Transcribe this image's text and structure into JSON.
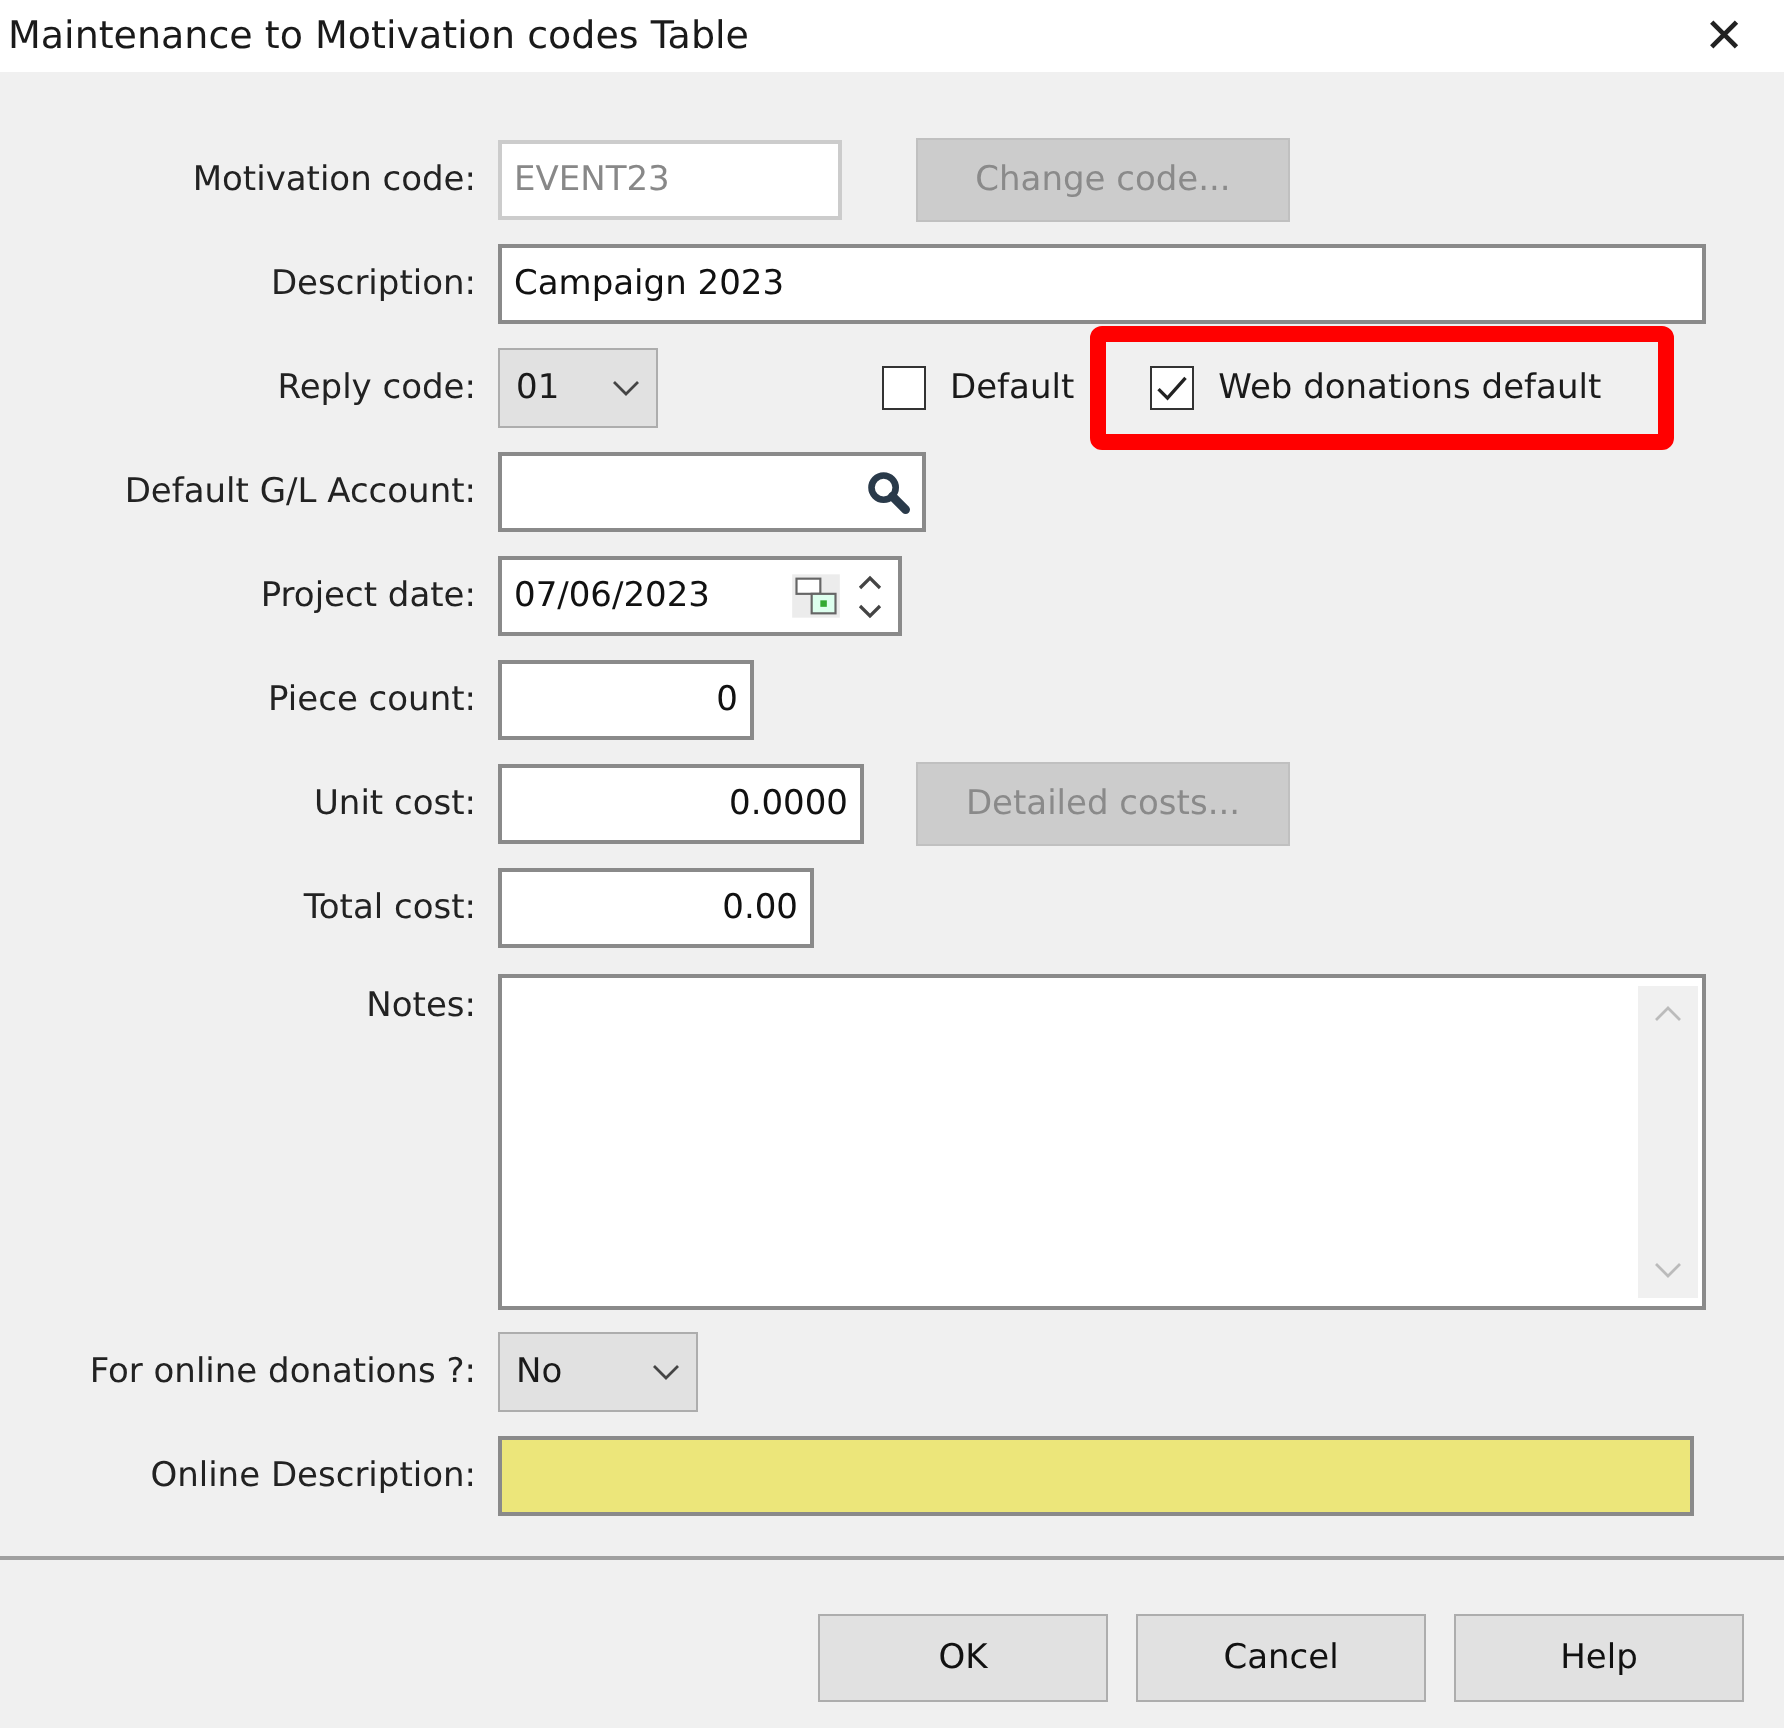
{
  "window": {
    "title": "Maintenance to Motivation codes Table",
    "close": "✕"
  },
  "motivation_code": {
    "label": "Motivation code:",
    "value": "EVENT23",
    "disabled": true,
    "button": "Change code...",
    "button_disabled": true
  },
  "description": {
    "label": "Description:",
    "value": "Campaign 2023"
  },
  "reply_code": {
    "label": "Reply code:",
    "value": "01"
  },
  "checkboxes": [
    {
      "label": "Default",
      "checked": false,
      "highlighted": false
    },
    {
      "label": "Web donations default",
      "checked": true,
      "highlighted": true
    }
  ],
  "gl_account": {
    "label": "Default G/L Account:"
  },
  "project_date": {
    "label": "Project date:",
    "value": "07/06/2023"
  },
  "piece_count": {
    "label": "Piece count:",
    "value": "0"
  },
  "unit_cost": {
    "label": "Unit cost:",
    "value": "0.0000",
    "button": "Detailed costs...",
    "button_disabled": true
  },
  "total_cost": {
    "label": "Total cost:",
    "value": "0.00"
  },
  "notes": {
    "label": "Notes:"
  },
  "online_donations": {
    "label": "For online donations ?:",
    "value": "No"
  },
  "online_description": {
    "label": "Online Description:",
    "required": true
  },
  "buttons": [
    "OK",
    "Cancel",
    "Help"
  ]
}
